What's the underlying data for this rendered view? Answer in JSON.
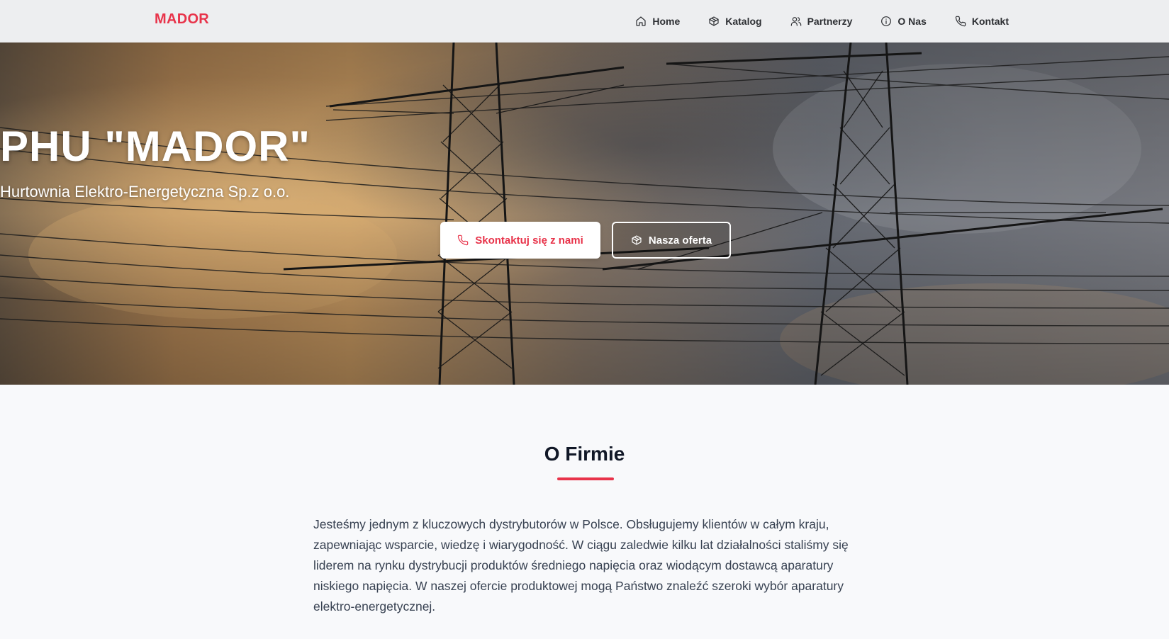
{
  "brand": "MADOR",
  "nav": {
    "items": [
      {
        "label": "Home",
        "icon": "home-icon"
      },
      {
        "label": "Katalog",
        "icon": "box-icon"
      },
      {
        "label": "Partnerzy",
        "icon": "users-icon"
      },
      {
        "label": "O Nas",
        "icon": "info-icon"
      },
      {
        "label": "Kontakt",
        "icon": "phone-icon"
      }
    ]
  },
  "hero": {
    "title": "PHU \"MADOR\"",
    "subtitle": "Hurtownia Elektro-Energetyczna Sp.z o.o.",
    "primary_button": "Skontaktuj się z nami",
    "secondary_button": "Nasza oferta"
  },
  "about": {
    "title": "O Firmie",
    "text": "Jesteśmy jednym z kluczowych dystrybutorów w Polsce. Obsługujemy klientów w całym kraju, zapewniając wsparcie, wiedzę i wiarygodność. W ciągu zaledwie kilku lat działalności staliśmy się liderem na rynku dystrybucji produktów średniego napięcia oraz wiodącym dostawcą aparatury niskiego napięcia. W naszej ofercie produktowej mogą Państwo znaleźć szeroki wybór aparatury elektro-energetycznej."
  },
  "colors": {
    "accent": "#e8334a",
    "nav_bg": "#ecedef",
    "page_bg": "#f8f9fb"
  }
}
